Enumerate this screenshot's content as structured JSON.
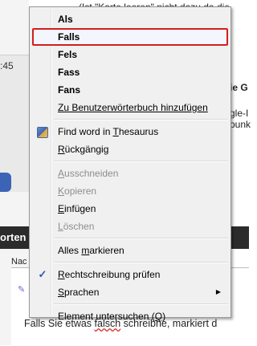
{
  "background": {
    "top_text": "(Ist \"Karte leeren\" nicht dazu da die",
    "time_text": ":45",
    "dark_bar_label": "orten",
    "nach_label": "Nac",
    "bottom_text_prefix": "Falls Sie etwas ",
    "bottom_text_misspelled": "falsch",
    "bottom_text_suffix": " schreibne, markiert d",
    "right_text_1": "ie G",
    "right_text_2": "gle-I",
    "right_text_3": "punk"
  },
  "context_menu": {
    "items": [
      {
        "label": "Als",
        "style": "bold"
      },
      {
        "label": "Falls",
        "style": "bold",
        "selected": true
      },
      {
        "label": "Fels",
        "style": "bold"
      },
      {
        "label": "Fass",
        "style": "bold"
      },
      {
        "label": "Fans",
        "style": "bold"
      },
      {
        "label_prefix": "Zu Benutzerwörterbuch hinzufügen"
      },
      {
        "label_prefix": "Find word in ",
        "label_underlined": "T",
        "label_suffix": "hesaurus",
        "icon": "thesaurus-book-icon"
      },
      {
        "label_underlined": "R",
        "label_suffix": "ückgängig"
      },
      {
        "label_underlined": "A",
        "label_suffix": "usschneiden",
        "disabled": true
      },
      {
        "label_underlined": "K",
        "label_suffix": "opieren",
        "disabled": true
      },
      {
        "label_underlined": "E",
        "label_suffix": "infügen"
      },
      {
        "label_underlined": "L",
        "label_suffix": "öschen",
        "disabled": true
      },
      {
        "label_prefix": "Alles ",
        "label_underlined": "m",
        "label_suffix": "arkieren"
      },
      {
        "label_underlined": "R",
        "label_suffix": "echtschreibung prüfen",
        "icon": "check-icon",
        "checked": true
      },
      {
        "label_underlined": "S",
        "label_suffix": "prachen",
        "submenu": true
      },
      {
        "label_prefix": "Element untersuchen (",
        "label_underlined": "Q",
        "label_suffix": ")"
      }
    ]
  },
  "colors": {
    "menu_background": "#f0f0f0",
    "selection_outline": "#d31d1d",
    "check_color": "#2f56b7",
    "disabled_text": "#8d8d8d"
  }
}
